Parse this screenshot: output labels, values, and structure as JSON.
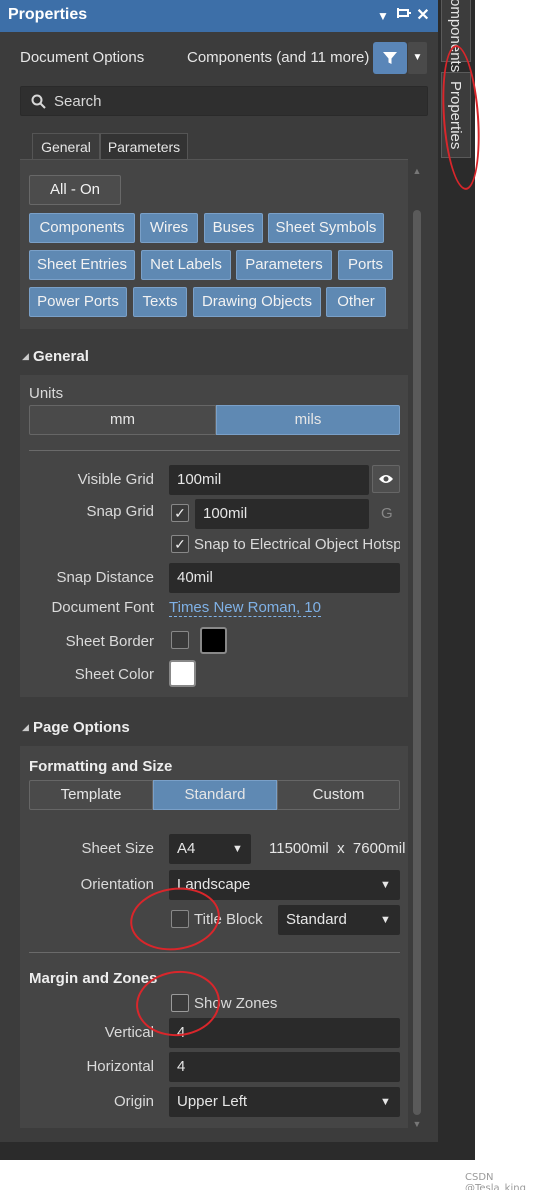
{
  "titlebar": {
    "title": "Properties",
    "menu_icon": "▼",
    "pin_icon": "pin-icon",
    "close_icon": "✕"
  },
  "header": {
    "document_options": "Document Options",
    "components_filter": "Components (and 11 more)"
  },
  "search": {
    "placeholder": "Search"
  },
  "tabs": [
    {
      "label": "General"
    },
    {
      "label": "Parameters"
    }
  ],
  "filter": {
    "all_on": "All - On",
    "chips": [
      "Components",
      "Wires",
      "Buses",
      "Sheet Symbols",
      "Sheet Entries",
      "Net Labels",
      "Parameters",
      "Ports",
      "Power Ports",
      "Texts",
      "Drawing Objects",
      "Other"
    ]
  },
  "general": {
    "title": "General",
    "units_label": "Units",
    "unit_mm": "mm",
    "unit_mils": "mils",
    "visible_grid_label": "Visible Grid",
    "visible_grid_value": "100mil",
    "snap_grid_label": "Snap Grid",
    "snap_grid_value": "100mil",
    "snap_grid_key": "G",
    "snap_electrical": "Snap to Electrical Object Hotspo",
    "snap_distance_label": "Snap Distance",
    "snap_distance_value": "40mil",
    "document_font_label": "Document Font",
    "document_font_value": "Times New Roman, 10",
    "sheet_border_label": "Sheet Border",
    "sheet_color_label": "Sheet Color"
  },
  "page_options": {
    "title": "Page Options",
    "formatting_title": "Formatting and Size",
    "mode_template": "Template",
    "mode_standard": "Standard",
    "mode_custom": "Custom",
    "sheet_size_label": "Sheet Size",
    "sheet_size_value": "A4",
    "sheet_dims": "11500mil  x  7600mil",
    "orientation_label": "Orientation",
    "orientation_value": "Landscape",
    "title_block_label": "Title Block",
    "title_block_value": "Standard",
    "margin_title": "Margin and Zones",
    "show_zones": "Show Zones",
    "vertical_label": "Vertical",
    "vertical_value": "4",
    "horizontal_label": "Horizontal",
    "horizontal_value": "4",
    "origin_label": "Origin",
    "origin_value": "Upper Left"
  },
  "side_tabs": {
    "components": "omponents",
    "properties": "Properties"
  },
  "colors": {
    "accent": "#5f89b3",
    "titlebar": "#3d6fa8",
    "annotation": "#d9262b",
    "sheet_color": "#ffffff",
    "sheet_border_swatch": "#000000"
  },
  "watermark": "CSDN @Tesla_king"
}
